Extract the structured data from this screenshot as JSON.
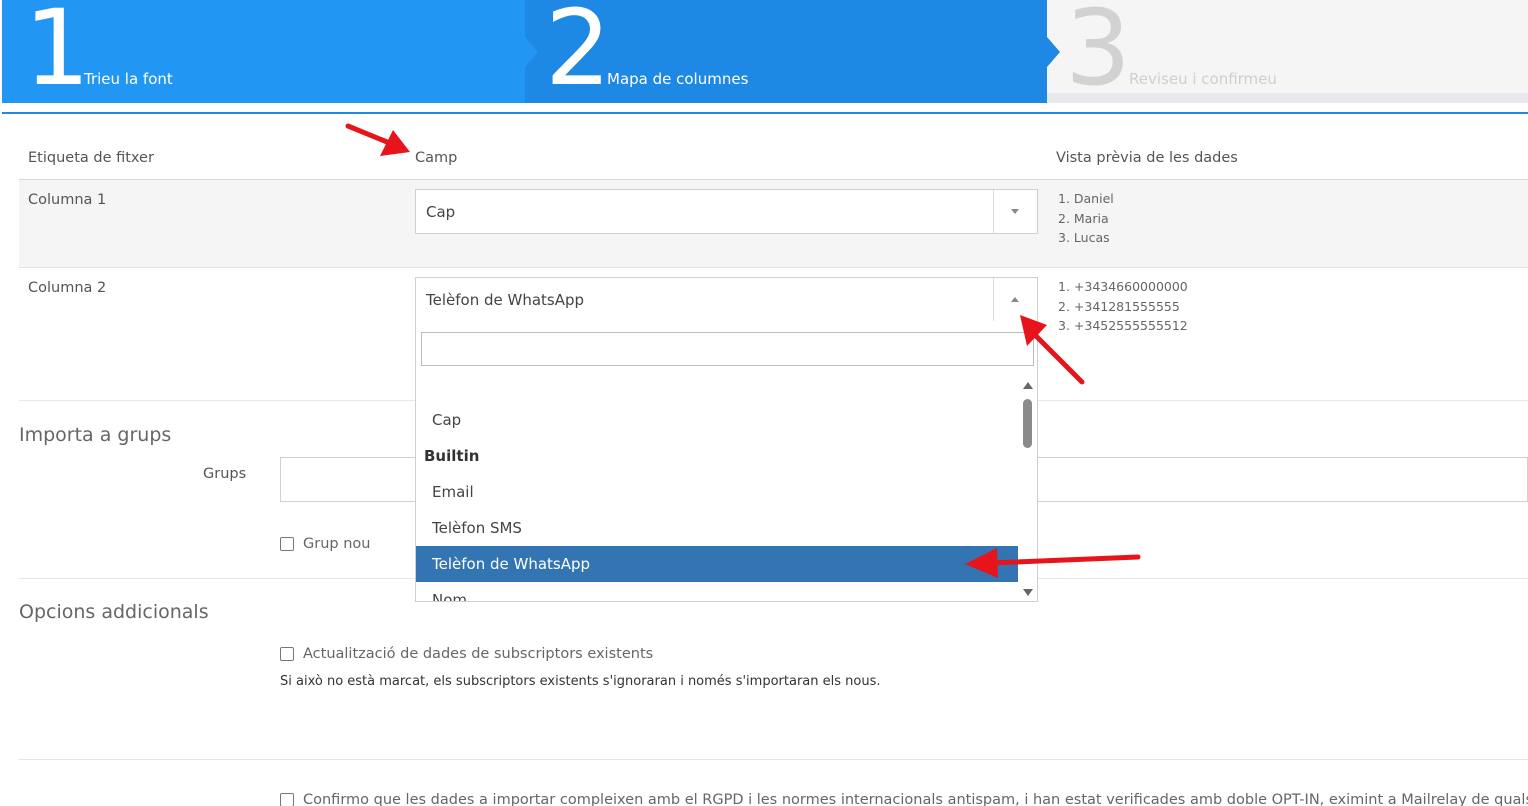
{
  "wizard": {
    "steps": [
      {
        "number": "1",
        "label": "Trieu la font",
        "state": "done"
      },
      {
        "number": "2",
        "label": "Mapa de columnes",
        "state": "active"
      },
      {
        "number": "3",
        "label": "Reviseu i confirmeu",
        "state": "pending"
      }
    ]
  },
  "mapping": {
    "headers": {
      "file_label": "Etiqueta de fitxer",
      "field": "Camp",
      "preview": "Vista prèvia de les dades"
    },
    "rows": [
      {
        "label": "Columna 1",
        "selected": "Cap",
        "preview": [
          "1. Daniel",
          "2. Maria",
          "3. Lucas"
        ]
      },
      {
        "label": "Columna 2",
        "selected": "Telèfon de WhatsApp",
        "preview": [
          "1. +3434660000000",
          "2. +341281555555",
          "3. +3452555555512"
        ]
      }
    ]
  },
  "dropdown": {
    "search_value": "",
    "options": [
      {
        "label": "Cap",
        "type": "item"
      },
      {
        "label": "Builtin",
        "type": "group"
      },
      {
        "label": "Email",
        "type": "item"
      },
      {
        "label": "Telèfon SMS",
        "type": "item"
      },
      {
        "label": "Telèfon de WhatsApp",
        "type": "item",
        "selected": true
      },
      {
        "label": "Nom",
        "type": "item"
      }
    ]
  },
  "groups_section": {
    "title": "Importa a grups",
    "groups_label": "Grups",
    "new_group_label": "Grup nou"
  },
  "options_section": {
    "title": "Opcions addicionals",
    "update_label": "Actualització de dades de subscriptors existents",
    "update_help": "Si això no està marcat, els subscriptors existents s'ignoraran i només s'importaran els nous.",
    "gdpr_label": "Confirmo que les dades a importar compleixen amb el RGPD i les normes internacionals antispam, i han estat verificades amb doble OPT-IN, eximint a Mailrelay de qualsevol"
  },
  "colors": {
    "step_done": "#2196f3",
    "step_active": "#1e88e5",
    "step_pending": "#f5f5f5",
    "selected_option": "#3375b3",
    "annotation_arrow": "#e8141b"
  }
}
